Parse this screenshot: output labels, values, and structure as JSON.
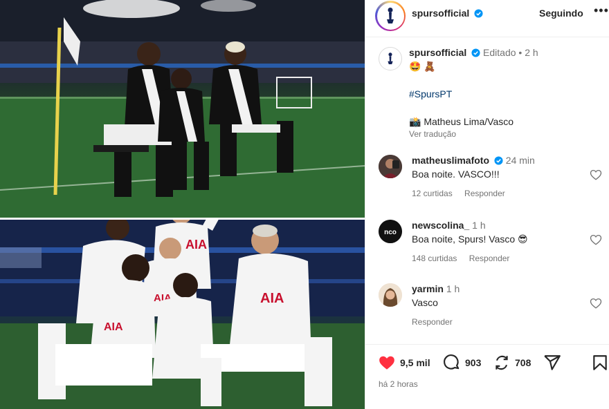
{
  "post": {
    "author": "spursofficial",
    "follow_label": "Seguindo",
    "more_label": "•••",
    "caption": {
      "author": "spursofficial",
      "edited": "Editado",
      "age": "2 h",
      "emojis": "🤩 🧸",
      "hashtag": "#SpursPT",
      "photo_credit": "📸 Matheus Lima/Vasco",
      "see_translation": "Ver tradução"
    },
    "comments": [
      {
        "user": "matheuslimafoto",
        "verified": true,
        "age": "24 min",
        "text": "Boa noite. VASCO!!!",
        "likes": "12 curtidas",
        "reply": "Responder"
      },
      {
        "user": "newscolina_",
        "verified": false,
        "age": "1 h",
        "text": "Boa noite, Spurs! Vasco 😎",
        "likes": "148 curtidas",
        "reply": "Responder"
      },
      {
        "user": "yarmin",
        "verified": false,
        "age": "1 h",
        "text": "Vasco",
        "likes": "",
        "reply": "Responder"
      }
    ],
    "actions": {
      "likes_count": "9,5 mil",
      "comments_count": "903",
      "reposts_count": "708"
    },
    "timestamp": "há 2 horas"
  },
  "colors": {
    "verified": "#0095f6",
    "like_red": "#ff3040",
    "hashtag": "#00376b"
  }
}
